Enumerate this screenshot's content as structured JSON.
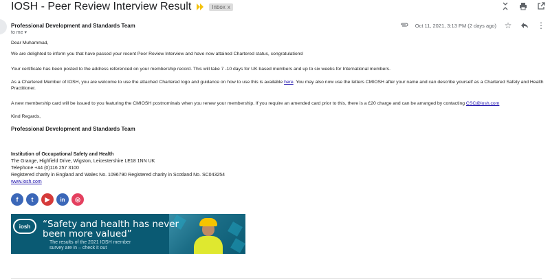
{
  "subject": "IOSH - Peer Review Interview Result",
  "label": "Inbox",
  "label_close": "x",
  "sender": "Professional Development and Standards Team",
  "to": "to me",
  "date": "Oct 11, 2021, 3:13 PM (2 days ago)",
  "body": {
    "greeting": "Dear Muhammad,",
    "p1": "We are delighted to inform you that have passed your recent Peer Review Interview and have now attained Chartered status, congratulations!",
    "p2": "Your certificate has been posted to the address referenced on your membership record. This will take 7 -10 days for UK based members and up to six weeks for International members.",
    "p3_a": "As a Chartered Member of IOSH, you are welcome to use the attached Chartered logo and guidance on how to use this is available ",
    "p3_link": "here",
    "p3_b": ". You may also now use the letters CMIOSH after your name and can describe yourself as a Chartered Safety and Health Practitioner.",
    "p4_a": "A new membership card will be issued to you featuring the CMIOSH postnominals when you renew your membership. If you require an amended card prior to this, there is a £20 charge and can be arranged by contacting ",
    "p4_link": "CSC@iosh.com",
    "closing": "Kind Regards,",
    "signature": "Professional Development and Standards Team"
  },
  "footer": {
    "org": "Institution of Occupational Safety and Health",
    "address": "The Grange, Highfield Drive, Wigston, Leicestershire LE18 1NN UK",
    "phone": "Telephone +44 (0)116 257 3100",
    "charity": "Registered charity in England and Wales No. 1096790 Registered charity in Scotland No. SC043254",
    "website": "www.iosh.com"
  },
  "social": [
    {
      "name": "facebook",
      "glyph": "f",
      "color": "#3b67b8"
    },
    {
      "name": "twitter",
      "glyph": "t",
      "color": "#3b67b8"
    },
    {
      "name": "youtube",
      "glyph": "▶",
      "color": "#d53a3a"
    },
    {
      "name": "linkedin",
      "glyph": "in",
      "color": "#3b67b8"
    },
    {
      "name": "instagram",
      "glyph": "◎",
      "color": "#e4405f"
    }
  ],
  "banner": {
    "logo": "iosh",
    "headline_1": "“Safety and health has never",
    "headline_2": "been more valued”",
    "sub_1": "The results of the 2021 IOSH member",
    "sub_2": "survey are in – check it out"
  },
  "icons": {
    "collapse": "collapse-icon",
    "print": "print-icon",
    "new_window": "open-new-window-icon",
    "attachment": "attachment-icon",
    "star": "star-icon",
    "reply": "reply-icon",
    "more": "more-vert-icon"
  },
  "colors": {
    "importance": "#f4c20d",
    "link": "#1a0dab",
    "banner_bg": "#0a5a73"
  }
}
